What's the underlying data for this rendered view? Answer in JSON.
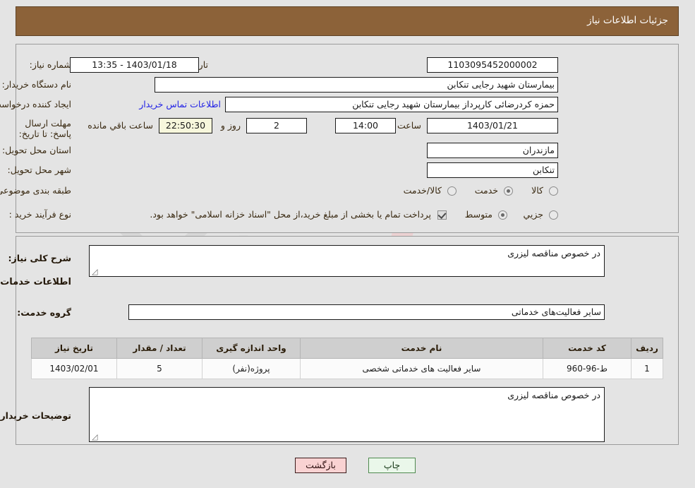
{
  "header": {
    "title": "جزئیات اطلاعات نیاز"
  },
  "form": {
    "need_number_label": "شماره نیاز:",
    "need_number_value": "1103095452000002",
    "announce_label": "تاریخ و ساعت اعلان عمومی:",
    "announce_value": "1403/01/18 - 13:35",
    "buyer_org_label": "نام دستگاه خریدار:",
    "buyer_org_value": "بیمارستان شهید رجایی تنکابن",
    "creator_label": "ایجاد کننده درخواست:",
    "creator_value": "حمزه کردرضائی کارپرداز بیمارستان شهید رجایی تنکابن",
    "contact_link": "اطلاعات تماس خریدار",
    "deadline_label": "مهلت ارسال پاسخ: تا تاریخ:",
    "deadline_date": "1403/01/21",
    "hour_label": "ساعت",
    "deadline_time": "14:00",
    "days_value": "2",
    "days_label": "روز و",
    "timer_value": "22:50:30",
    "timer_label": "ساعت باقي مانده",
    "province_label": "استان محل تحویل:",
    "province_value": "مازندران",
    "city_label": "شهر محل تحویل:",
    "city_value": "تنکابن",
    "category_label": "طبقه بندی موضوعی:",
    "category_options": [
      "کالا",
      "خدمت",
      "کالا/خدمت"
    ],
    "category_selected": "خدمت",
    "purchase_type_label": "نوع فرآیند خرید :",
    "purchase_options": [
      "جزیي",
      "متوسط"
    ],
    "purchase_selected": "متوسط",
    "treasury_checkbox_checked": true,
    "treasury_note": "پرداخت تمام یا بخشی از مبلغ خرید،از محل \"اسناد خزانه اسلامی\" خواهد بود."
  },
  "description": {
    "general_label": "شرح کلی نیاز:",
    "general_value": "در خصوص مناقصه لیزری",
    "services_heading": "اطلاعات خدمات مورد نیاز",
    "service_group_label": "گروه خدمت:",
    "service_group_value": "سایر فعالیت‌های خدماتی"
  },
  "table": {
    "columns": [
      "ردیف",
      "کد خدمت",
      "نام خدمت",
      "واحد اندازه گیری",
      "تعداد / مقدار",
      "تاریخ نیاز"
    ],
    "rows": [
      {
        "row": "1",
        "service_code": "ط-96-960",
        "service_name": "سایر فعالیت های خدماتی شخصی",
        "unit": "پروژه(نفر)",
        "quantity": "5",
        "need_date": "1403/02/01"
      }
    ]
  },
  "buyer_notes": {
    "label": "توضیحات خریدار:",
    "value": "در خصوص مناقصه لیزری"
  },
  "buttons": {
    "print": "چاپ",
    "back": "بازگشت"
  },
  "watermark": {
    "text": "AriaTender",
    "text2": ".net"
  },
  "colors": {
    "header_bg": "#8c6239",
    "link": "#2323e6",
    "timer_bg": "#f7f7dc",
    "btn_print_bg": "#eaf7ea",
    "btn_back_bg": "#f9d2d2"
  }
}
